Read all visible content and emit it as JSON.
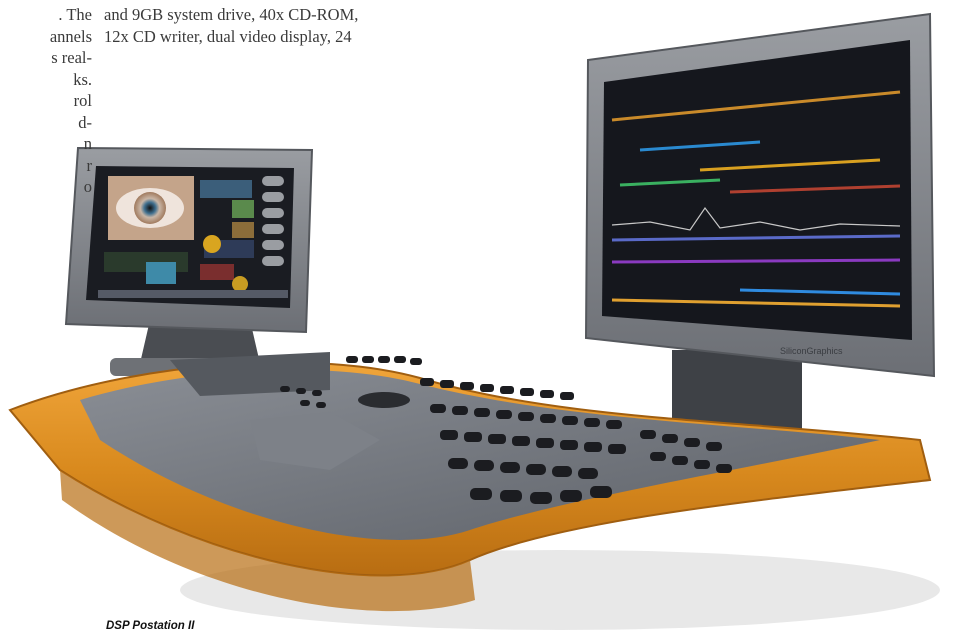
{
  "article": {
    "left_column_lines": [
      ". The",
      "annels",
      "s real-",
      "ks.",
      "rol",
      "d-",
      "n",
      "r",
      "o"
    ],
    "right_column_lines": [
      "and 9GB system drive, 40x CD-ROM,",
      "12x CD writer, dual video display, 24"
    ]
  },
  "photo": {
    "monitor_brand": "SiliconGraphics",
    "caption": "DSP Postation II"
  },
  "colors": {
    "wood_trim": "#d88a1c",
    "console_gray": "#6f737a",
    "screen_dark": "#14161c"
  }
}
